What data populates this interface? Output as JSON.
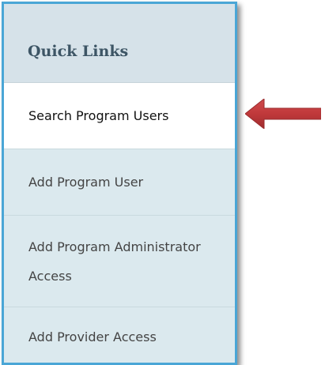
{
  "quick_links": {
    "title": "Quick Links",
    "items": [
      {
        "label": "Search Program Users",
        "selected": true
      },
      {
        "label": "Add Program User",
        "selected": false
      },
      {
        "label": "Add Program Administrator Access",
        "selected": false
      },
      {
        "label": "Add Provider Access",
        "selected": false
      }
    ]
  },
  "annotation": {
    "arrow_color": "#c0393b",
    "arrow_icon": "left-arrow-icon"
  },
  "colors": {
    "panel_border": "#4aa6d6",
    "panel_background": "#dce9ee",
    "title_text": "#3d5565"
  }
}
